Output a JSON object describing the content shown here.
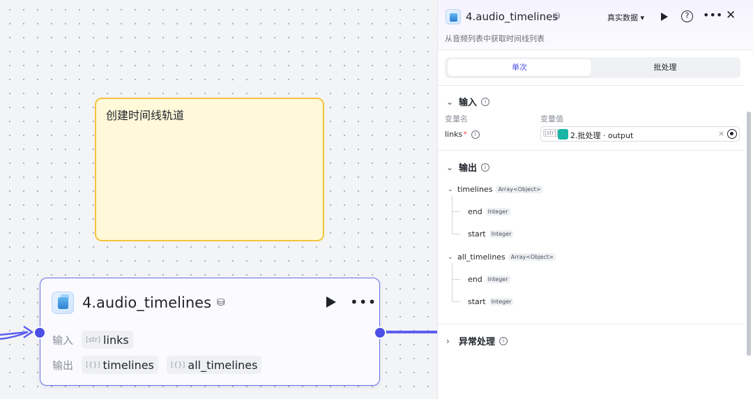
{
  "canvas": {
    "note": {
      "text": "创建时间线轨道"
    },
    "node": {
      "title": "4.audio_timelines",
      "input_label": "输入",
      "output_label": "输出",
      "inputs": [
        {
          "type": "[str]",
          "name": "links"
        }
      ],
      "outputs": [
        {
          "type": "[{}]",
          "name": "timelines"
        },
        {
          "type": "[{}]",
          "name": "all_timelines"
        }
      ]
    }
  },
  "panel": {
    "title": "4.audio_timelines",
    "mode_label": "真实数据 ▾",
    "description": "从音频列表中获取时间线列表",
    "tabs": {
      "single": "单次",
      "batch": "批处理"
    },
    "input_section": {
      "title": "输入",
      "col_name": "变量名",
      "col_value": "变量值",
      "var_name": "links",
      "var_required": "*",
      "var_type": "[str]",
      "var_ref": "2.批处理 · output"
    },
    "output_section": {
      "title": "输出",
      "tree": [
        {
          "name": "timelines",
          "type": "Array<Object>",
          "children": [
            {
              "name": "end",
              "type": "Integer"
            },
            {
              "name": "start",
              "type": "Integer"
            }
          ]
        },
        {
          "name": "all_timelines",
          "type": "Array<Object>",
          "children": [
            {
              "name": "end",
              "type": "Integer"
            },
            {
              "name": "start",
              "type": "Integer"
            }
          ]
        }
      ]
    },
    "error_section": {
      "title": "异常处理"
    }
  },
  "colors": {
    "accent": "#4b4fe6",
    "note_border": "#f5c33b",
    "note_bg": "#fff8d9",
    "ref_icon": "#19b5a6"
  },
  "icons": [
    "node-cube-icon",
    "store-icon",
    "play-icon",
    "more-icon",
    "help-icon",
    "close-icon",
    "info-icon",
    "chevron-down-icon",
    "chevron-right-icon",
    "target-icon",
    "clear-icon"
  ]
}
